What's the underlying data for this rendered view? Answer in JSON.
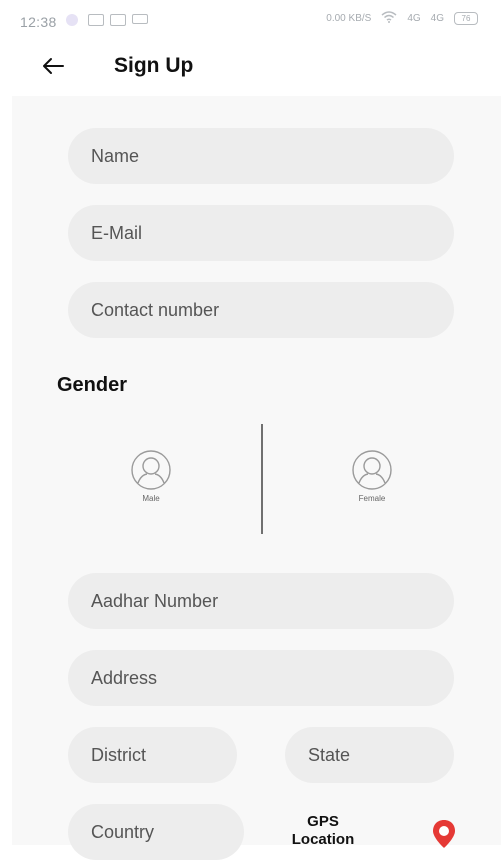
{
  "status_bar": {
    "time": "12:38",
    "network_speed": "0.00 KB/S",
    "signal_1": "4G",
    "signal_2": "4G",
    "battery": "76"
  },
  "header": {
    "title": "Sign Up"
  },
  "form": {
    "name": {
      "placeholder": "Name"
    },
    "email": {
      "placeholder": "E-Mail"
    },
    "contact": {
      "placeholder": "Contact number"
    },
    "gender_heading": "Gender",
    "gender_options": [
      {
        "label": "Male"
      },
      {
        "label": "Female"
      }
    ],
    "aadhar": {
      "placeholder": "Aadhar Number"
    },
    "address": {
      "placeholder": "Address"
    },
    "district": {
      "placeholder": "District"
    },
    "state": {
      "placeholder": "State"
    },
    "country": {
      "placeholder": "Country"
    },
    "gps_label": "GPS Location"
  },
  "colors": {
    "field_background": "#ededed",
    "content_background": "#f8f8f8",
    "gps_pin": "#e53935"
  }
}
